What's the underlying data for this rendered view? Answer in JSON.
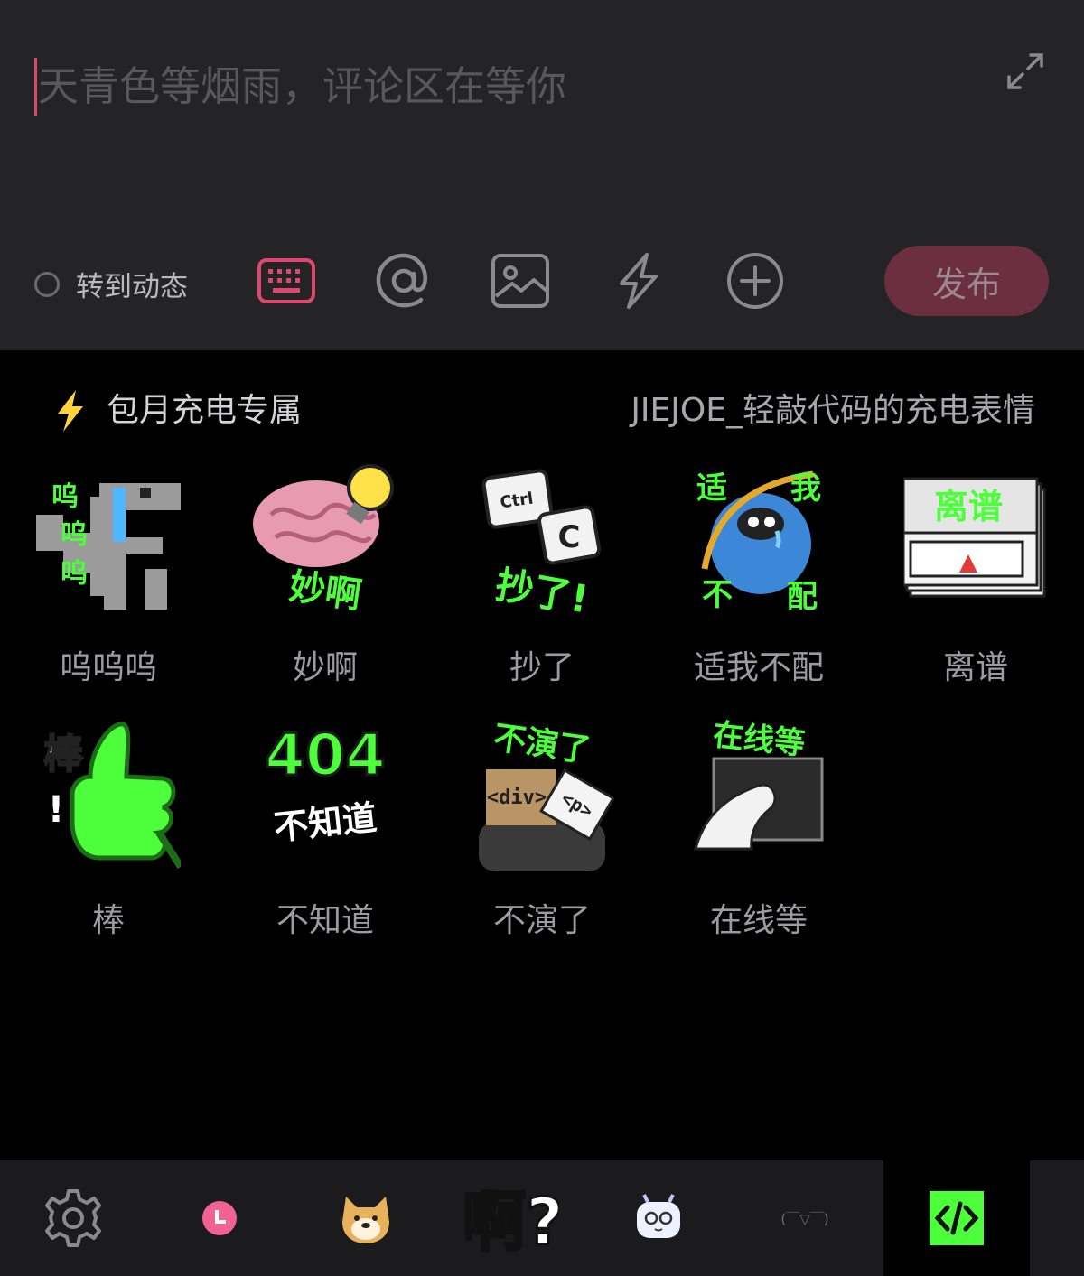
{
  "composer": {
    "placeholder": "天青色等烟雨，评论区在等你",
    "repost_label": "转到动态",
    "publish_label": "发布",
    "toolbar_icons": [
      "keyboard-icon",
      "at-icon",
      "image-icon",
      "bolt-icon",
      "plus-circle-icon",
      "expand-icon"
    ]
  },
  "panel": {
    "title": "包月充电专属",
    "author": "JIEJOE_轻敲代码的充电表情",
    "stickers": [
      {
        "label": "呜呜呜",
        "art_text": "呜呜呜"
      },
      {
        "label": "妙啊",
        "art_text": "妙啊"
      },
      {
        "label": "抄了",
        "art_text": "抄了!",
        "key1": "Ctrl",
        "key2": "C"
      },
      {
        "label": "适我不配",
        "art_text": "适我不配"
      },
      {
        "label": "离谱",
        "art_text": "离谱"
      },
      {
        "label": "棒",
        "art_text": "棒!"
      },
      {
        "label": "不知道",
        "art_text": "不知道",
        "big": "404"
      },
      {
        "label": "不演了",
        "art_text": "不演了",
        "tag1": "<div>",
        "tag2": "<p>"
      },
      {
        "label": "在线等",
        "art_text": "在线等"
      }
    ]
  },
  "tabs": [
    {
      "icon": "gear-icon"
    },
    {
      "icon": "recent-clock-icon"
    },
    {
      "icon": "doge-icon"
    },
    {
      "icon": "a-question-icon",
      "text": "啊?"
    },
    {
      "icon": "tv-mascot-icon"
    },
    {
      "icon": "kaomoji-icon",
      "text": "(￣▽￣)"
    },
    {
      "icon": "code-sticker-icon",
      "active": true
    }
  ],
  "colors": {
    "accent_pink": "#e0476f",
    "publish_bg": "#6c2f41",
    "neon_green": "#4cff3a",
    "bolt_yellow": "#ffd43a"
  }
}
